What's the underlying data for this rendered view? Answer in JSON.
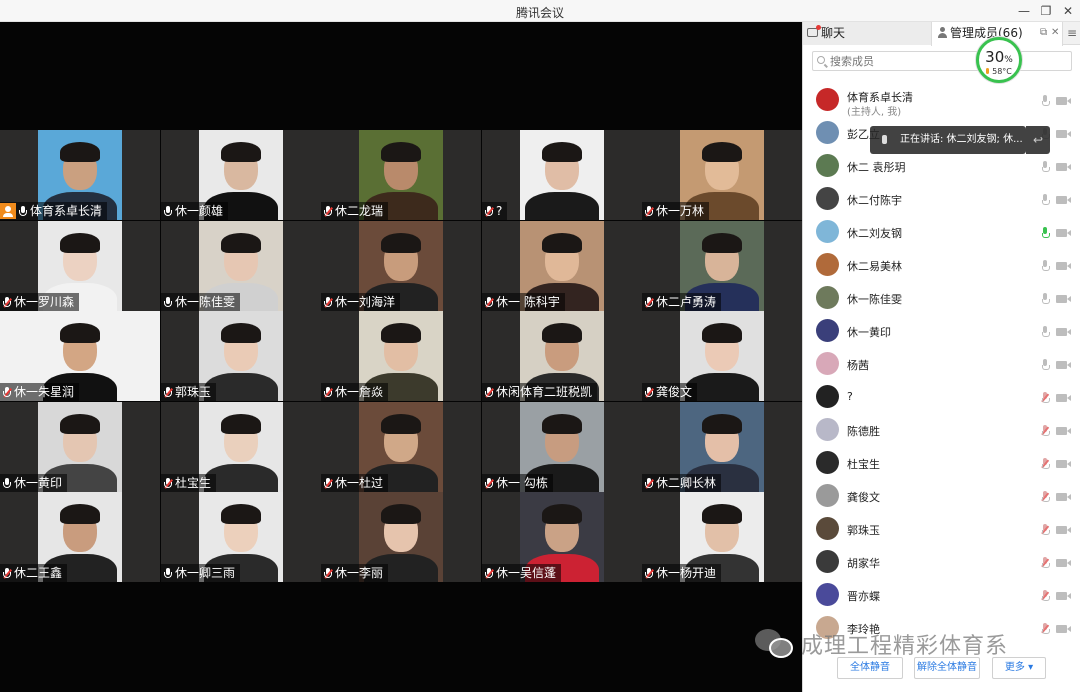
{
  "window": {
    "title": "腾讯会议",
    "minimize": "—",
    "restore": "❐",
    "close": "✕"
  },
  "tiles": [
    {
      "name": "体育系卓长清",
      "mic": "on",
      "host": true,
      "scene": "#5aa8d8",
      "wall": "#8fc6ea",
      "skin": "#caa080",
      "shirt": "#243040"
    },
    {
      "name": "休一颜雄",
      "mic": "on",
      "scene": "#e9e9e9",
      "wall": "#2c2b2a",
      "skin": "#d9b8a0",
      "shirt": "#111"
    },
    {
      "name": "休二龙瑞",
      "mic": "muted",
      "scene": "#5a6f34",
      "wall": "#839353",
      "skin": "#b98a6b",
      "shirt": "#3d2a1c"
    },
    {
      "name": "?",
      "mic": "muted",
      "scene": "#efefef",
      "wall": "#2c2b2a",
      "skin": "#e0bda6",
      "shirt": "#1a1a1a"
    },
    {
      "name": "休一万林",
      "mic": "muted",
      "scene": "#c49a72",
      "wall": "#2c2b2a",
      "skin": "#e2bb98",
      "shirt": "#6b4a2c"
    },
    {
      "name": "休一罗川森",
      "mic": "muted",
      "scene": "#e8e8e8",
      "wall": "#2c2b2a",
      "skin": "#ecd2c2",
      "shirt": "#f2f2f2"
    },
    {
      "name": "休一陈佳雯",
      "mic": "on",
      "scene": "#d8d2c8",
      "wall": "#a89a8a",
      "skin": "#e6c7b3",
      "shirt": "#d0d0d0"
    },
    {
      "name": "休一刘海洋",
      "mic": "muted",
      "scene": "#6b4b3a",
      "wall": "#8a6050",
      "skin": "#c89c7c",
      "shirt": "#222"
    },
    {
      "name": "休一 陈科宇",
      "mic": "muted",
      "scene": "#b89274",
      "wall": "#d6b69a",
      "skin": "#e0b898",
      "shirt": "#332420"
    },
    {
      "name": "休二卢勇涛",
      "mic": "muted",
      "scene": "#5b6a58",
      "wall": "#87987e",
      "skin": "#d8b499",
      "shirt": "#25305a"
    },
    {
      "name": "休一朱星润",
      "mic": "muted",
      "scene": "#f2f2f2",
      "wall": "#f2f2f2",
      "skin": "#d3a684",
      "shirt": "#111"
    },
    {
      "name": "郭珠玉",
      "mic": "muted",
      "scene": "#dcdcdc",
      "wall": "#2c2b2a",
      "skin": "#eacbb6",
      "shirt": "#2a2a2a"
    },
    {
      "name": "休一詹焱",
      "mic": "muted",
      "scene": "#d9d4c6",
      "wall": "#c8c2b4",
      "skin": "#e2bea4",
      "shirt": "#3c3a2c"
    },
    {
      "name": "休闲体育二班税凯",
      "mic": "muted",
      "scene": "#d6d0c4",
      "wall": "#bdb6a8",
      "skin": "#c99c7e",
      "shirt": "#2a2a2a"
    },
    {
      "name": "龚俊文",
      "mic": "muted",
      "scene": "#e0e0e0",
      "wall": "#2c2b2a",
      "skin": "#ebcab6",
      "shirt": "#1a1a1a"
    },
    {
      "name": "休一黄印",
      "mic": "on",
      "scene": "#d8d8d8",
      "wall": "#2c2b2a",
      "skin": "#e4c6b2",
      "shirt": "#444"
    },
    {
      "name": "杜宝生",
      "mic": "muted",
      "scene": "#e6e6e6",
      "wall": "#2c2b2a",
      "skin": "#ead0bd",
      "shirt": "#2a2a2a"
    },
    {
      "name": "休一杜过",
      "mic": "muted",
      "scene": "#6b4b3a",
      "wall": "#8a6050",
      "skin": "#d0a888",
      "shirt": "#222"
    },
    {
      "name": "休一 勾栋",
      "mic": "muted",
      "scene": "#9aa0a4",
      "wall": "#c4c8ca",
      "skin": "#c79c80",
      "shirt": "#1a1a1a"
    },
    {
      "name": "休二卿长林",
      "mic": "muted",
      "scene": "#4d6680",
      "wall": "#6e869e",
      "skin": "#e4bfa8",
      "shirt": "#2a3040"
    },
    {
      "name": "休二王鑫",
      "mic": "muted",
      "scene": "#e6e6e6",
      "wall": "#cfcfcf",
      "skin": "#c99c7e",
      "shirt": "#222"
    },
    {
      "name": "休一卿三雨",
      "mic": "on",
      "scene": "#e8e8e8",
      "wall": "#2c2b2a",
      "skin": "#ecd0bc",
      "shirt": "#2a2a2a"
    },
    {
      "name": "休一李丽",
      "mic": "muted",
      "scene": "#5a4236",
      "wall": "#7c5a4a",
      "skin": "#e6c4ad",
      "shirt": "#222"
    },
    {
      "name": "休一吴信蓬",
      "mic": "muted",
      "scene": "#3b3b44",
      "wall": "#5a5a66",
      "skin": "#caa286",
      "shirt": "#cc2233"
    },
    {
      "name": "休一杨开迪",
      "mic": "muted",
      "scene": "#ececec",
      "wall": "#2c2b2a",
      "skin": "#e2c0a8",
      "shirt": "#333"
    }
  ],
  "panel": {
    "chat_tab": "聊天",
    "members_tab": "管理成员(66)",
    "menu": "≡",
    "search_placeholder": "搜索成员",
    "perf": {
      "percent": "30",
      "unit": "%",
      "temp": "58°C"
    },
    "speaking_tip": "正在讲话: 休二刘友钢; 休...",
    "members": [
      {
        "name": "体育系卓长清",
        "sub": "(主持人, 我)",
        "mic": "off",
        "avatar": "#c62828"
      },
      {
        "name": "彭乙立",
        "mic": "off",
        "avatar": "#6f8fb2"
      },
      {
        "name": "休二 袁彤玥",
        "mic": "off",
        "avatar": "#5c7a52"
      },
      {
        "name": "休二付陈宇",
        "mic": "off",
        "avatar": "#444444"
      },
      {
        "name": "休二刘友钢",
        "mic": "on",
        "avatar": "#7fb6d8"
      },
      {
        "name": "休二易美林",
        "mic": "off",
        "avatar": "#b06a3a"
      },
      {
        "name": "休一陈佳雯",
        "mic": "off",
        "avatar": "#6e7a5c"
      },
      {
        "name": "休一黄印",
        "mic": "off",
        "avatar": "#3a3f7a"
      },
      {
        "name": "杨茜",
        "mic": "off",
        "avatar": "#d8a8b8"
      },
      {
        "name": "?",
        "mic": "muted",
        "avatar": "#222222"
      },
      {
        "name": "陈德胜",
        "mic": "muted",
        "avatar": "#b8b8c8"
      },
      {
        "name": "杜宝生",
        "mic": "muted",
        "avatar": "#2a2a2a"
      },
      {
        "name": "龚俊文",
        "mic": "muted",
        "avatar": "#9a9a9a"
      },
      {
        "name": "郭珠玉",
        "mic": "muted",
        "avatar": "#5a4a3a"
      },
      {
        "name": "胡家华",
        "mic": "muted",
        "avatar": "#3a3a3a"
      },
      {
        "name": "晋亦蝶",
        "mic": "muted",
        "avatar": "#4a4a9a"
      },
      {
        "name": "李玲艳",
        "mic": "muted",
        "avatar": "#c8a890"
      }
    ],
    "mute_all": "全体静音",
    "unmute_all": "解除全体静音",
    "more": "更多 ▾"
  },
  "watermark": "成理工程精彩体育系"
}
